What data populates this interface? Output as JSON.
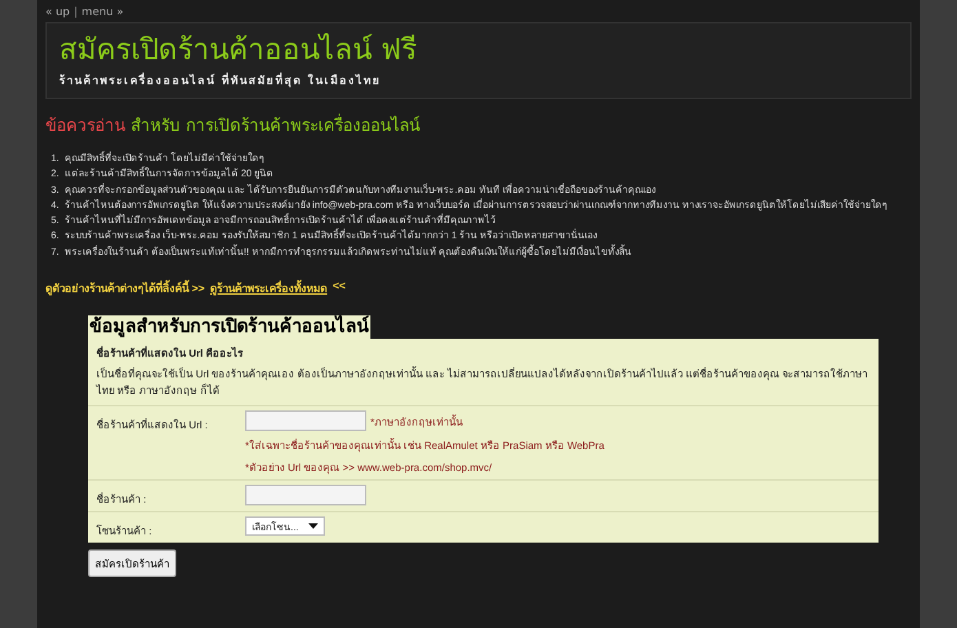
{
  "nav": {
    "up": "« up",
    "separator": "|",
    "menu": "menu »"
  },
  "header": {
    "title": "สมัครเปิดร้านค้าออนไลน์ ฟรี",
    "subtitle": "ร้านค้าพระเครื่องออนไลน์ ที่ทันสมัยที่สุด ในเมืองไทย"
  },
  "notice": {
    "warning": "ข้อควรอ่าน",
    "heading": "สำหรับ การเปิดร้านค้าพระเครื่องออนไลน์"
  },
  "rules": [
    {
      "number": "1.",
      "text": "คุณมีสิทธิ์ที่จะเปิดร้านค้า โดยไม่มีค่าใช้จ่ายใดๆ"
    },
    {
      "number": "2.",
      "text": "แต่ละร้านค้ามีสิทธิ์ในการจัดการข้อมูลได้ 20 ยูนิต"
    },
    {
      "number": "3.",
      "text": "คุณควรที่จะกรอกข้อมูลส่วนตัวของคุณ และ ได้รับการยืนยันการมีตัวตนกับทางทีมงานเว็บ-พระ.คอม ทันที เพื่อความน่าเชื่อถือของร้านค้าคุณเอง"
    },
    {
      "number": "4.",
      "text": "ร้านค้าไหนต้องการอัพเกรดยูนิต ให้แจ้งความประสงค์มายัง info@web-pra.com หรือ ทางเว็บบอร์ด เมื่อผ่านการตรวจสอบว่าผ่านเกณฑ์จากทางทีมงาน ทางเราจะอัพเกรดยูนิตให้โดยไม่เสียค่าใช้จ่ายใดๆ"
    },
    {
      "number": "5.",
      "text": "ร้านค้าไหนที่ไม่มีการอัพเดทข้อมูล อาจมีการถอนสิทธิ์การเปิดร้านค้าได้ เพื่อคงแต่ร้านค้าที่มีคุณภาพไว้"
    },
    {
      "number": "6.",
      "text": "ระบบร้านค้าพระเครื่อง เว็บ-พระ.คอม รองรับให้สมาชิก 1 คนมีสิทธิ์ที่จะเปิดร้านค้าได้มากกว่า 1 ร้าน หรือว่าเปิดหลายสาขานั่นเอง"
    },
    {
      "number": "7.",
      "text": "พระเครื่องในร้านค้า ต้องเป็นพระแท้เท่านั้น!! หากมีการทำธุรกรรมแล้วเกิดพระท่านไม่แท้ คุณต้องคืนเงินให้แก่ผู้ซื้อโดยไม่มีเงื่อนไขทั้งสิ้น"
    }
  ],
  "examples": {
    "before": "ดูตัวอย่างร้านค้าต่างๆได้ที่ลิ้งค์นี้ >>",
    "link": "ดูร้านค้าพระเครื่องทั้งหมด",
    "after": "<<"
  },
  "form": {
    "legend": "ข้อมูลสำหรับการเปิดร้านค้าออนไลน์",
    "help_title": "ชื่อร้านค้าที่แสดงใน Url คืออะไร",
    "help_text": "เป็นชื่อที่คุณจะใช้เป็น Url ของร้านค้าคุณเอง ต้องเป็นภาษาอังกฤษเท่านั้น และ ไม่สามารถเปลี่ยนแปลงได้หลังจากเปิดร้านค้าไปแล้ว แต่ชื่อร้านค้าของคุณ จะสามารถใช้ภาษาไทย หรือ ภาษาอังกฤษ ก็ได้",
    "rows": [
      {
        "kind": "text",
        "label": "ชื่อร้านค้าที่แสดงใน Url :",
        "inline_note": "*ภาษาอังกฤษเท่านั้น",
        "notes": [
          "*ใส่เฉพาะชื่อร้านค้าของคุณเท่านั้น เช่น RealAmulet หรือ PraSiam หรือ WebPra",
          "*ตัวอย่าง Url ของคุณ >> www.web-pra.com/shop.mvc/"
        ]
      },
      {
        "kind": "text",
        "label": "ชื่อร้านค้า :"
      },
      {
        "kind": "select",
        "label": "โซนร้านค้า :",
        "value": "เลือกโซน..."
      }
    ],
    "submit": "สมัครเปิดร้านค้า"
  }
}
